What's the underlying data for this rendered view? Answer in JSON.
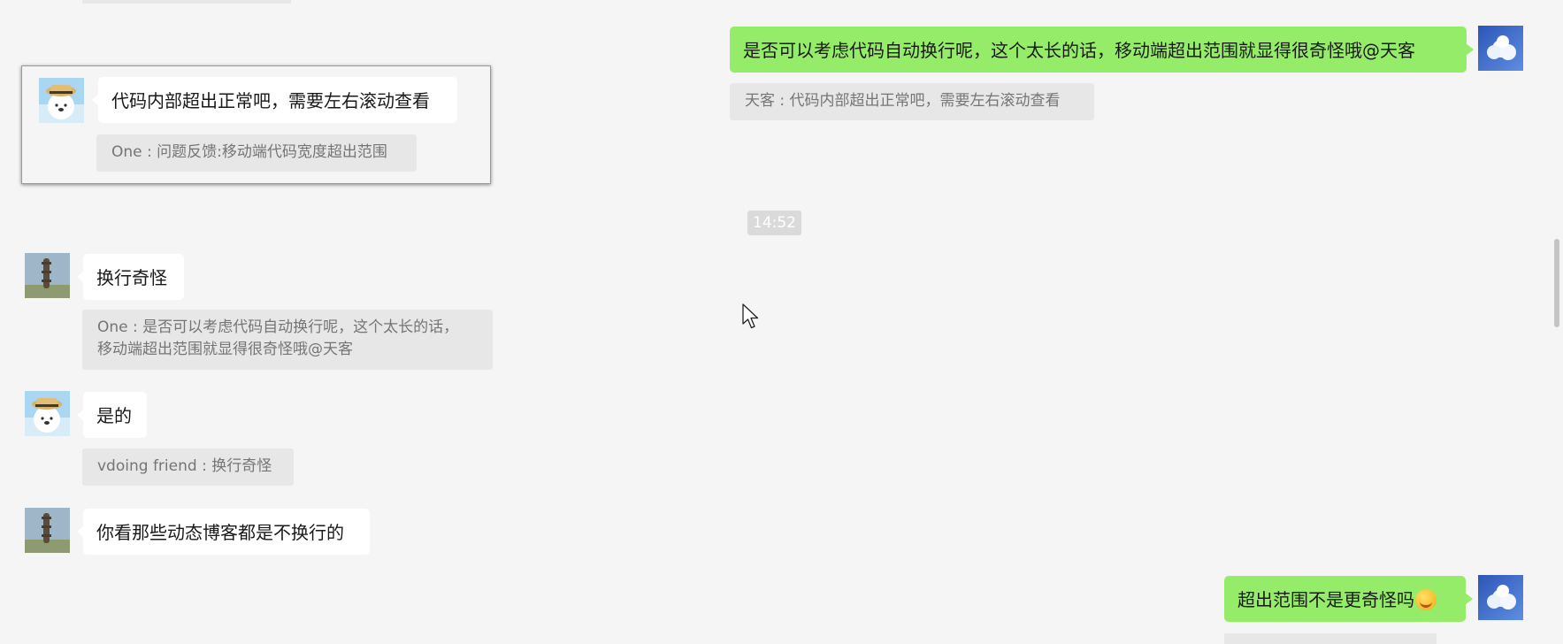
{
  "messages": [
    {
      "side": "right",
      "text": "是否可以考虑代码自动换行呢，这个太长的话，移动端超出范围就显得很奇怪哦@天客",
      "quote": "天客 : 代码内部超出正常吧，需要左右滚动查看"
    },
    {
      "side": "left",
      "text": "换行奇怪",
      "quote_line1": "One : 是否可以考虑代码自动换行呢，这个太长的话，",
      "quote_line2": "移动端超出范围就显得很奇怪哦@天客"
    },
    {
      "side": "left",
      "text": "是的",
      "quote": "vdoing friend : 换行奇怪"
    },
    {
      "side": "left",
      "text": "你看那些动态博客都是不换行的"
    },
    {
      "side": "right",
      "text": "超出范围不是更奇怪吗",
      "emoji": "laughing-tears-emoji"
    }
  ],
  "timestamp": "14:52",
  "popup": {
    "text": "代码内部超出正常吧，需要左右滚动查看",
    "quote": "One : 问题反馈:移动端代码宽度超出范围"
  },
  "colors": {
    "background": "#f5f5f5",
    "my_bubble": "#95ec69",
    "other_bubble": "#ffffff",
    "quote_bg": "#e7e7e7"
  }
}
